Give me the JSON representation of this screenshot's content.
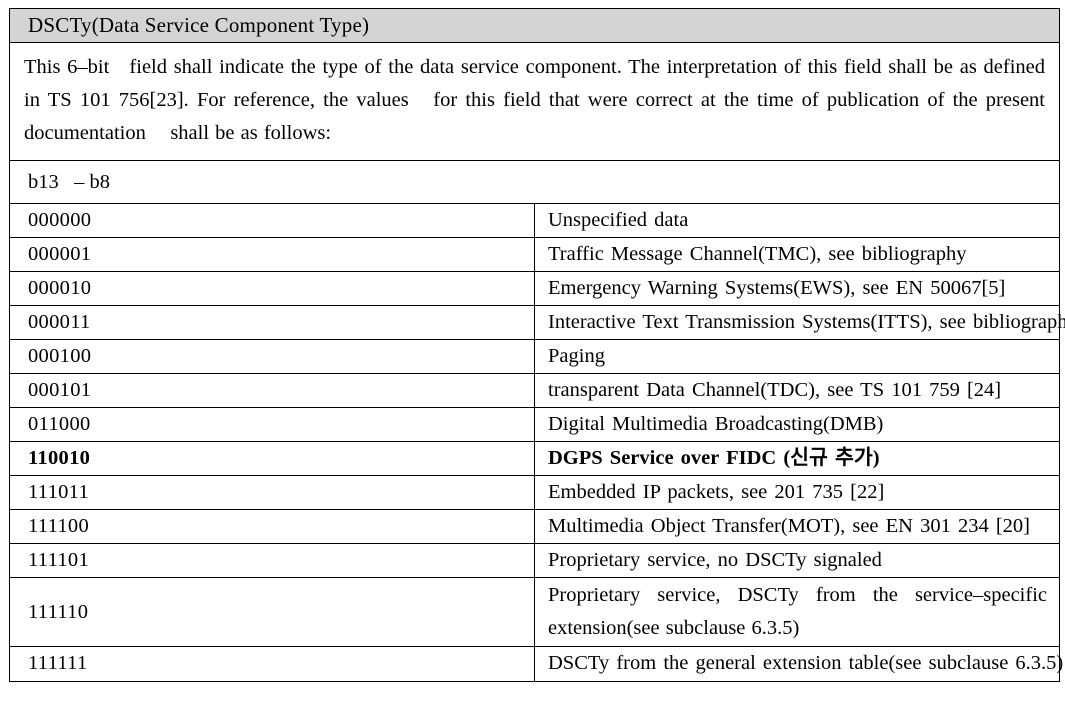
{
  "section": {
    "header_title": "DSCTy(Data Service Component Type)",
    "description": "This 6–bit   field shall indicate the type of the data service component. The interpretation of this field shall be as defined in TS 101 756[23]. For reference, the values   for this field that were correct at the time of publication of the present documentation    shall be as follows:"
  },
  "values_table": {
    "bits_header": "b13   – b8",
    "rows": [
      {
        "code": "000000",
        "description": "Unspecified data",
        "bold": false
      },
      {
        "code": "000001",
        "description": "Traffic Message Channel(TMC), see bibliography",
        "bold": false
      },
      {
        "code": "000010",
        "description": "Emergency Warning Systems(EWS), see EN 50067[5]",
        "bold": false
      },
      {
        "code": "000011",
        "description": "Interactive Text Transmission Systems(ITTS), see bibliography",
        "bold": false
      },
      {
        "code": "000100",
        "description": "Paging",
        "bold": false
      },
      {
        "code": "000101",
        "description": "transparent Data Channel(TDC), see TS 101 759 [24]",
        "bold": false
      },
      {
        "code": "011000",
        "description": "Digital Multimedia Broadcasting(DMB)",
        "bold": false
      },
      {
        "code": "110010",
        "description": "DGPS Service over FIDC (신규 추가)",
        "bold": true
      },
      {
        "code": "111011",
        "description": "Embedded IP packets, see 201 735 [22]",
        "bold": false
      },
      {
        "code": "111100",
        "description": "Multimedia Object Transfer(MOT), see EN 301 234 [20]",
        "bold": false
      },
      {
        "code": "111101",
        "description": "Proprietary service, no DSCTy signaled",
        "bold": false
      },
      {
        "code": "111110",
        "description": "Proprietary service, DSCTy from the service–specific extension(see subclause 6.3.5)",
        "bold": false,
        "tall": true
      },
      {
        "code": "111111",
        "description": "DSCTy from the general extension table(see subclause 6.3.5)",
        "bold": false
      }
    ]
  },
  "colors": {
    "header_background": "#d4d4d4",
    "border": "#000000",
    "text": "#000000",
    "page_background": "#ffffff"
  }
}
